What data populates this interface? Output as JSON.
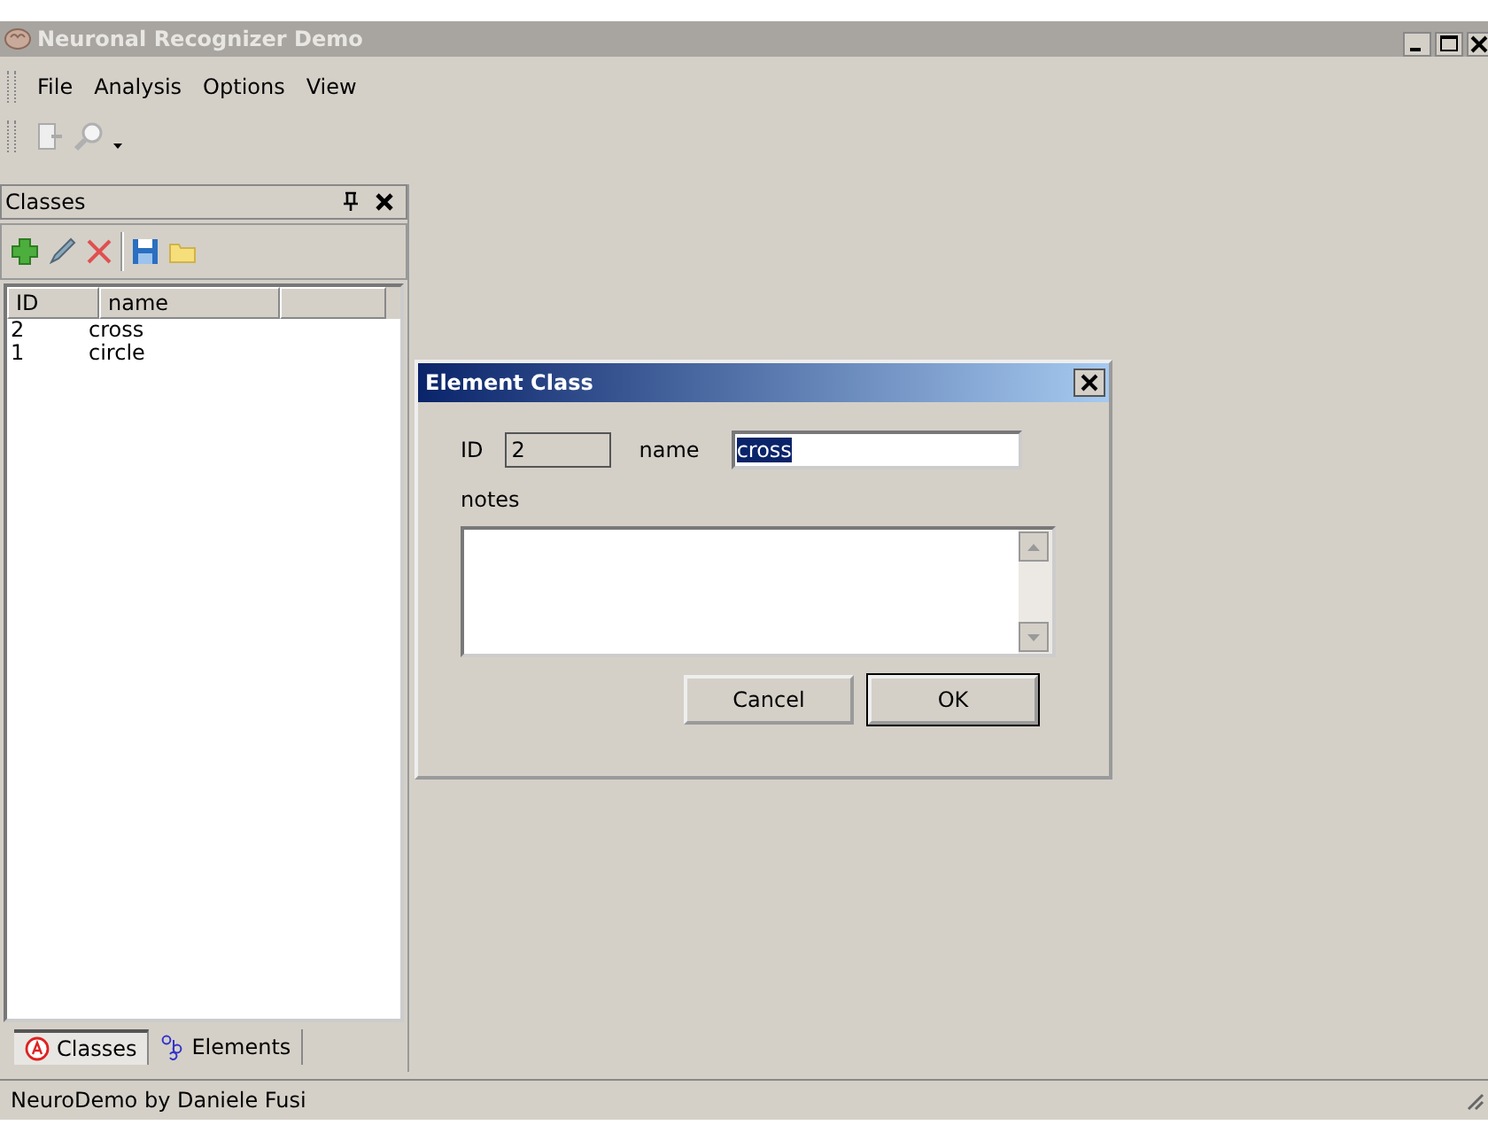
{
  "window": {
    "title": "Neuronal Recognizer Demo"
  },
  "menu": [
    "File",
    "Analysis",
    "Options",
    "View"
  ],
  "panel": {
    "title": "Classes",
    "columns": [
      "ID",
      "name"
    ],
    "rows": [
      {
        "id": "2",
        "name": "cross",
        "selected": false
      },
      {
        "id": "1",
        "name": "circle",
        "selected": false
      }
    ]
  },
  "panel_tabs": [
    {
      "label": "Classes",
      "selected": true
    },
    {
      "label": "Elements",
      "selected": false
    }
  ],
  "status_bar": "NeuroDemo by Daniele Fusi",
  "dialog": {
    "title": "Element Class",
    "id_label": "ID",
    "id_value": "2",
    "name_label": "name",
    "name_value": "cross",
    "notes_label": "notes",
    "buttons": [
      {
        "label": "Cancel",
        "default": false
      },
      {
        "label": "OK",
        "default": true
      }
    ]
  }
}
